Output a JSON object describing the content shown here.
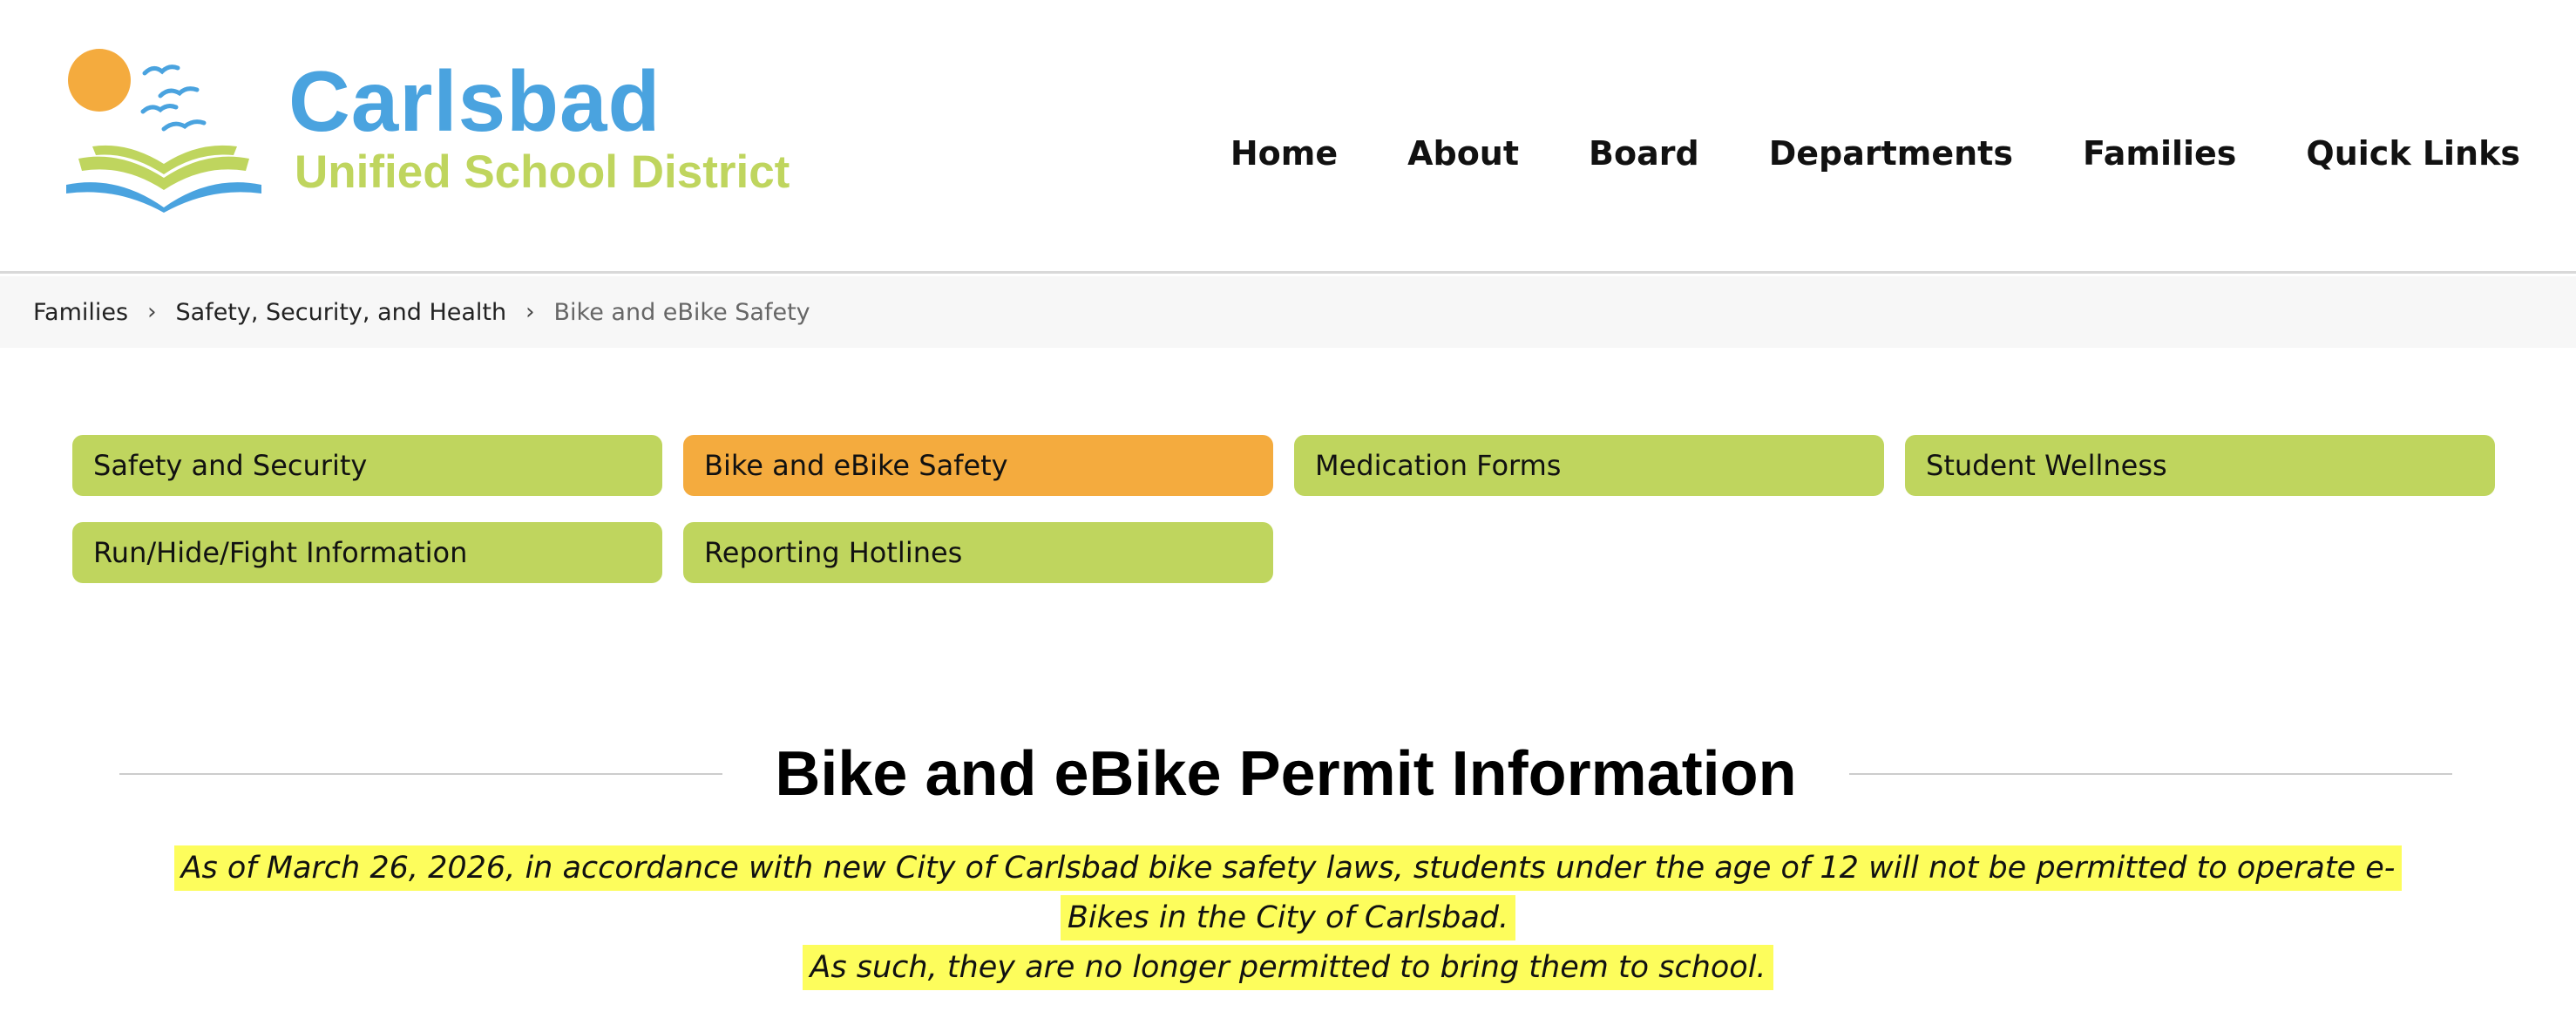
{
  "brand": {
    "title": "Carlsbad",
    "subtitle": "Unified School District",
    "colors": {
      "blue": "#4aa3df",
      "green": "#bfd55e",
      "orange": "#f4ab3e",
      "highlight": "#fdfd5c"
    }
  },
  "nav": {
    "items": [
      "Home",
      "About",
      "Board",
      "Departments",
      "Families",
      "Quick Links"
    ]
  },
  "breadcrumb": {
    "items": [
      "Families",
      "Safety, Security, and Health"
    ],
    "current": "Bike and eBike Safety",
    "separator_icon": "chevron-right-icon"
  },
  "tiles": [
    {
      "label": "Safety and Security",
      "active": false
    },
    {
      "label": "Bike and eBike Safety",
      "active": true
    },
    {
      "label": "Medication Forms",
      "active": false
    },
    {
      "label": "Student Wellness",
      "active": false
    },
    {
      "label": "Run/Hide/Fight Information",
      "active": false
    },
    {
      "label": "Reporting Hotlines",
      "active": false
    }
  ],
  "main": {
    "heading": "Bike and eBike Permit Information",
    "notice_line1": "As of March 26, 2026, in accordance with new City of Carlsbad bike safety laws, students under the age of 12 will not be permitted to operate e-Bikes in the City of Carlsbad.",
    "notice_line2": "As such, they are no longer permitted to bring them to school."
  }
}
